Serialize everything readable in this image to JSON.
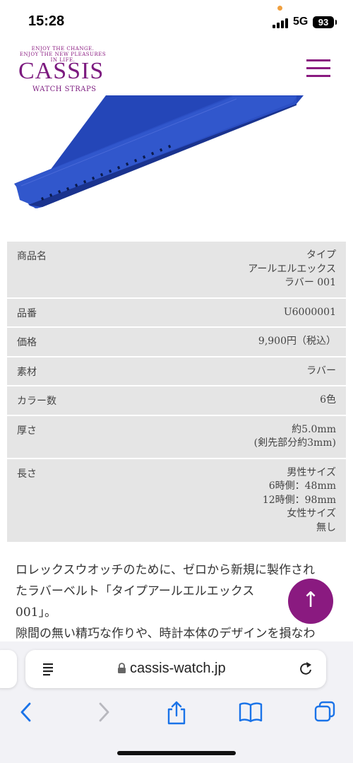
{
  "status": {
    "time": "15:28",
    "network": "5G",
    "battery": "93"
  },
  "header": {
    "tagline_1": "ENJOY THE CHANGE.",
    "tagline_2": "ENJOY THE NEW PLEASURES IN LIFE.",
    "logo": "CASSIS",
    "logo_sub": "WATCH STRAPS"
  },
  "spec": {
    "rows": [
      {
        "label": "商品名",
        "lines": [
          "タイプ",
          "アールエルエックス",
          "ラバー 001"
        ]
      },
      {
        "label": "品番",
        "lines": [
          "U6000001"
        ]
      },
      {
        "label": "価格",
        "lines": [
          "9,900円（税込）"
        ]
      },
      {
        "label": "素材",
        "lines": [
          "ラバー"
        ]
      },
      {
        "label": "カラー数",
        "lines": [
          "6色"
        ]
      },
      {
        "label": "厚さ",
        "lines": [
          "約5.0mm",
          "(剣先部分約3mm)"
        ]
      },
      {
        "label": "長さ",
        "lines": [
          "男性サイズ",
          "6時側：48mm",
          "12時側：98mm",
          "女性サイズ",
          "無し"
        ]
      }
    ]
  },
  "description": {
    "line_1": "ロレックスウオッチのために、ゼロから新規に製作され",
    "line_2": "たラバーベルト「タイプアールエルエックス",
    "line_3": "001」。",
    "line_4": "隙間の無い精巧な作りや、時計本体のデザインを損なわ"
  },
  "scroll_top_label": "↑",
  "browser": {
    "url": "cassis-watch.jp"
  },
  "colors": {
    "brand": "#7c1a7f",
    "strap": "#2b4fc4",
    "table_bg": "#e5e5e5"
  }
}
